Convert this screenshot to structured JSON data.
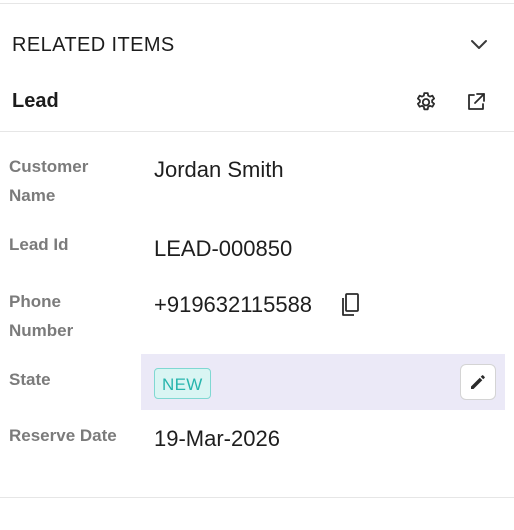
{
  "section": {
    "title": "RELATED ITEMS",
    "toggle_icon": "chevron-down-icon"
  },
  "card": {
    "title": "Lead",
    "settings_icon": "gear-icon",
    "open_icon": "external-link-icon"
  },
  "fields": {
    "customer_name": {
      "label": "Customer Name",
      "value": "Jordan Smith"
    },
    "lead_id": {
      "label": "Lead Id",
      "value": "LEAD-000850"
    },
    "phone": {
      "label": "Phone Number",
      "value": "+919632115588",
      "copy_icon": "copy-icon"
    },
    "state": {
      "label": "State",
      "value": "NEW",
      "edit_icon": "pencil-icon"
    },
    "reserve_date": {
      "label": "Reserve Date",
      "value": "19-Mar-2026"
    }
  },
  "colors": {
    "state_badge_text": "#27b5ad",
    "state_badge_bg": "#d9f5f3",
    "state_row_highlight": "#ebe9f7"
  }
}
